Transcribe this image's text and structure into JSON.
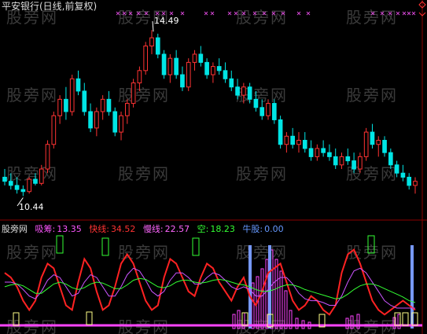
{
  "title": "平安银行(日线,前复权)",
  "price_panel": {
    "high_marker": "14.49",
    "low_marker": "10.44"
  },
  "indicator_legend": {
    "name": "股旁网",
    "items": [
      {
        "label": "吸筹:",
        "value": "13.35",
        "color": "#ff55ff"
      },
      {
        "label": "快线:",
        "value": "34.52",
        "color": "#ff3333"
      },
      {
        "label": "慢线:",
        "value": "22.57",
        "color": "#ff66ff"
      },
      {
        "label": "空:",
        "value": "18.23",
        "color": "#33ff33"
      },
      {
        "label": "牛股:",
        "value": "0.00",
        "color": "#6699ff"
      }
    ]
  },
  "watermark": "股旁网",
  "colors": {
    "up": "#ff3333",
    "down": "#00e5e5",
    "fast": "#ff2222",
    "slow": "#cc55ff",
    "kong": "#33ff33",
    "niu": "#7799ff",
    "xichou": "#ff44ff",
    "marker": "#ffff88",
    "signal": "#33ff33",
    "cross": "#cc44cc"
  },
  "chart_data": [
    {
      "type": "candlestick",
      "title": "平安银行(日线,前复权)",
      "annotations": [
        {
          "label": "14.49",
          "kind": "high"
        },
        {
          "label": "10.44",
          "kind": "low"
        }
      ],
      "ylim": [
        10.2,
        14.8
      ],
      "candles": [
        [
          10.9,
          11.1,
          10.7,
          10.8
        ],
        [
          10.8,
          11.0,
          10.6,
          10.7
        ],
        [
          10.7,
          10.9,
          10.5,
          10.6
        ],
        [
          10.6,
          10.7,
          10.44,
          10.55
        ],
        [
          10.55,
          10.9,
          10.5,
          10.85
        ],
        [
          10.85,
          11.0,
          10.7,
          10.75
        ],
        [
          10.75,
          11.2,
          10.7,
          11.1
        ],
        [
          11.1,
          11.8,
          11.0,
          11.7
        ],
        [
          11.7,
          12.5,
          11.6,
          12.4
        ],
        [
          12.4,
          12.9,
          12.2,
          12.8
        ],
        [
          12.8,
          13.1,
          12.3,
          12.5
        ],
        [
          12.5,
          13.4,
          12.4,
          13.3
        ],
        [
          13.3,
          13.5,
          12.9,
          13.0
        ],
        [
          13.0,
          13.2,
          12.4,
          12.5
        ],
        [
          12.5,
          12.7,
          12.0,
          12.1
        ],
        [
          12.1,
          12.6,
          11.9,
          12.5
        ],
        [
          12.5,
          12.9,
          12.3,
          12.8
        ],
        [
          12.8,
          13.0,
          12.4,
          12.5
        ],
        [
          12.5,
          12.6,
          11.9,
          12.0
        ],
        [
          12.0,
          12.5,
          11.8,
          12.4
        ],
        [
          12.4,
          12.8,
          12.2,
          12.7
        ],
        [
          12.7,
          13.3,
          12.6,
          13.2
        ],
        [
          13.2,
          13.6,
          13.0,
          13.5
        ],
        [
          13.5,
          14.2,
          13.4,
          14.1
        ],
        [
          14.1,
          14.49,
          13.9,
          14.3
        ],
        [
          14.3,
          14.4,
          13.8,
          13.9
        ],
        [
          13.9,
          14.0,
          13.3,
          13.4
        ],
        [
          13.4,
          13.9,
          13.2,
          13.8
        ],
        [
          13.8,
          14.0,
          13.3,
          13.4
        ],
        [
          13.4,
          13.6,
          13.0,
          13.1
        ],
        [
          13.1,
          13.8,
          13.0,
          13.7
        ],
        [
          13.7,
          14.0,
          13.5,
          13.9
        ],
        [
          13.9,
          14.1,
          13.6,
          13.7
        ],
        [
          13.7,
          13.8,
          13.3,
          13.4
        ],
        [
          13.4,
          13.7,
          13.2,
          13.6
        ],
        [
          13.6,
          13.8,
          13.4,
          13.5
        ],
        [
          13.5,
          13.7,
          13.2,
          13.3
        ],
        [
          13.3,
          13.5,
          13.0,
          13.1
        ],
        [
          13.1,
          13.3,
          12.8,
          12.9
        ],
        [
          12.9,
          13.2,
          12.7,
          13.1
        ],
        [
          13.1,
          13.2,
          12.7,
          12.8
        ],
        [
          12.8,
          13.0,
          12.5,
          12.6
        ],
        [
          12.6,
          12.8,
          12.3,
          12.4
        ],
        [
          12.4,
          12.8,
          12.3,
          12.7
        ],
        [
          12.7,
          12.8,
          12.2,
          12.3
        ],
        [
          12.3,
          12.4,
          11.6,
          11.7
        ],
        [
          11.7,
          12.0,
          11.5,
          11.9
        ],
        [
          11.9,
          12.1,
          11.6,
          11.7
        ],
        [
          11.7,
          12.0,
          11.5,
          11.8
        ],
        [
          11.8,
          12.0,
          11.5,
          11.6
        ],
        [
          11.6,
          11.8,
          11.3,
          11.4
        ],
        [
          11.4,
          11.7,
          11.3,
          11.6
        ],
        [
          11.6,
          11.8,
          11.4,
          11.5
        ],
        [
          11.5,
          11.7,
          11.3,
          11.4
        ],
        [
          11.4,
          11.6,
          11.1,
          11.2
        ],
        [
          11.2,
          11.5,
          11.1,
          11.4
        ],
        [
          11.4,
          11.6,
          11.2,
          11.3
        ],
        [
          11.3,
          11.5,
          11.0,
          11.1
        ],
        [
          11.1,
          11.5,
          11.0,
          11.4
        ],
        [
          11.4,
          12.1,
          11.3,
          12.0
        ],
        [
          12.0,
          12.2,
          11.6,
          11.7
        ],
        [
          11.7,
          11.9,
          11.4,
          11.8
        ],
        [
          11.8,
          11.9,
          11.4,
          11.5
        ],
        [
          11.5,
          11.6,
          11.1,
          11.2
        ],
        [
          11.2,
          11.3,
          10.9,
          11.0
        ],
        [
          11.0,
          11.2,
          10.8,
          10.9
        ],
        [
          10.9,
          11.0,
          10.6,
          10.7
        ],
        [
          10.7,
          10.9,
          10.5,
          10.8
        ]
      ]
    },
    {
      "type": "line",
      "series": [
        {
          "name": "快线",
          "values": [
            60,
            55,
            45,
            30,
            20,
            30,
            55,
            70,
            65,
            45,
            25,
            20,
            50,
            75,
            65,
            40,
            20,
            25,
            45,
            70,
            80,
            70,
            50,
            30,
            20,
            25,
            55,
            75,
            70,
            55,
            40,
            35,
            55,
            70,
            65,
            50,
            40,
            30,
            45,
            55,
            35,
            25,
            40,
            60,
            65,
            70,
            50,
            30,
            20,
            25,
            35,
            30,
            20,
            15,
            25,
            60,
            80,
            85,
            70,
            50,
            30,
            20,
            15,
            20,
            25,
            30,
            25,
            20
          ]
        },
        {
          "name": "慢线",
          "values": [
            50,
            50,
            48,
            42,
            35,
            32,
            40,
            52,
            58,
            55,
            45,
            35,
            38,
            50,
            58,
            55,
            45,
            35,
            35,
            45,
            58,
            65,
            62,
            52,
            40,
            35,
            40,
            52,
            60,
            60,
            55,
            48,
            48,
            55,
            60,
            58,
            52,
            45,
            42,
            45,
            42,
            35,
            35,
            42,
            50,
            55,
            55,
            48,
            38,
            32,
            30,
            30,
            28,
            25,
            25,
            35,
            50,
            62,
            65,
            60,
            50,
            40,
            30,
            25,
            22,
            22,
            22,
            22
          ]
        },
        {
          "name": "空",
          "values": [
            45,
            47,
            48,
            46,
            42,
            38,
            38,
            43,
            48,
            50,
            48,
            44,
            42,
            44,
            48,
            50,
            49,
            46,
            43,
            43,
            47,
            52,
            54,
            53,
            49,
            45,
            44,
            46,
            50,
            52,
            52,
            50,
            49,
            50,
            52,
            53,
            52,
            50,
            48,
            47,
            45,
            42,
            40,
            40,
            42,
            45,
            47,
            47,
            45,
            42,
            40,
            38,
            36,
            34,
            32,
            33,
            37,
            42,
            46,
            48,
            48,
            46,
            43,
            40,
            37,
            34,
            30,
            28
          ]
        },
        {
          "name": "牛股",
          "values": [
            0,
            0,
            0,
            0,
            0,
            0,
            0,
            0,
            0,
            0,
            0,
            0,
            0,
            0,
            0,
            0,
            0,
            0,
            0,
            0,
            0,
            0,
            0,
            0,
            0,
            0,
            0,
            0,
            0,
            0,
            0,
            0,
            0,
            0,
            0,
            0,
            0,
            0,
            0,
            0,
            0,
            0,
            0,
            0,
            0,
            0,
            0,
            0,
            0,
            0,
            0,
            0,
            0,
            0,
            0,
            0,
            0,
            0,
            0,
            0,
            0,
            0,
            0,
            0,
            0,
            0,
            0,
            0
          ]
        }
      ]
    }
  ]
}
